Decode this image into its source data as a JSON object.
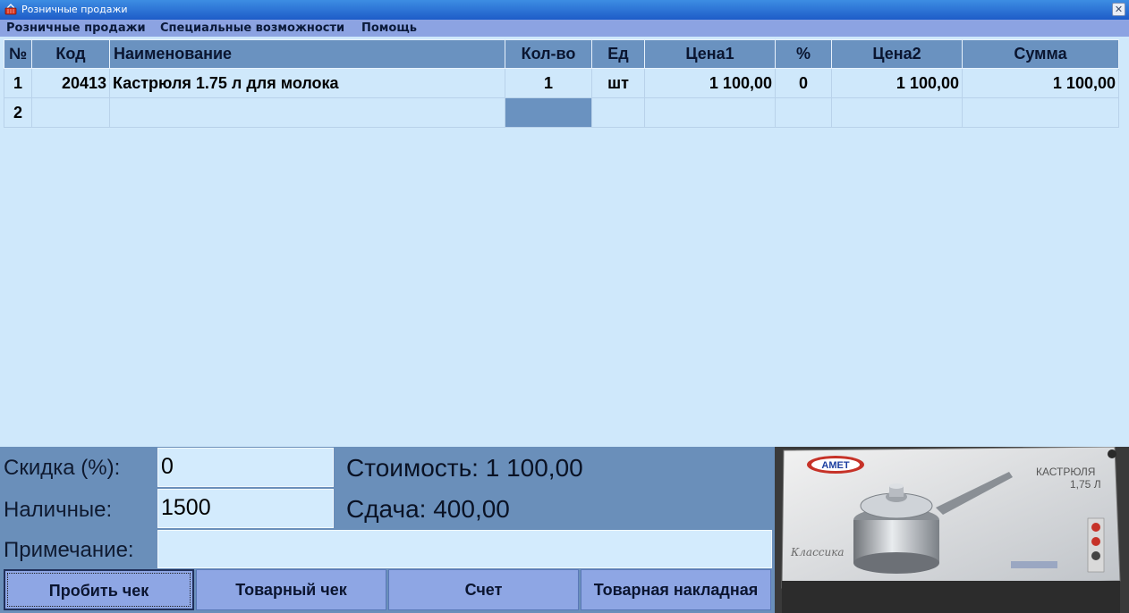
{
  "window": {
    "title": "Розничные продажи"
  },
  "menu": [
    "Розничные продажи",
    "Специальные возможности",
    "Помощь"
  ],
  "table": {
    "headers": [
      "№",
      "Код",
      "Наименование",
      "Кол-во",
      "Ед",
      "Цена1",
      "%",
      "Цена2",
      "Сумма"
    ],
    "rows": [
      [
        "1",
        "20413",
        "Кастрюля 1.75 л для молока",
        "1",
        "шт",
        "1 100,00",
        "0",
        "1 100,00",
        "1 100,00"
      ],
      [
        "2",
        "",
        "",
        "",
        "",
        "",
        "",
        "",
        ""
      ]
    ]
  },
  "form": {
    "discount_label": "Скидка (%):",
    "discount_value": "0",
    "cash_label": "Наличные:",
    "cash_value": "1500",
    "note_label": "Примечание:",
    "note_value": ""
  },
  "totals": {
    "cost": "Стоимость: 1 100,00",
    "change": "Сдача: 400,00"
  },
  "product_image": {
    "brand": "АМЕТ",
    "box_text_1": "КАСТРЮЛЯ",
    "box_text_2": "1,75 Л",
    "script_text": "Классика"
  },
  "buttons": [
    "Пробить чек",
    "Товарный чек",
    "Счет",
    "Товарная накладная"
  ],
  "colors": {
    "grid_bg": "#cfe8fb",
    "header_bg": "#6a92c0",
    "panel_bg": "#6a8fba",
    "button_bg": "#8ea6e4",
    "title_bar": "#1e5cc8"
  }
}
